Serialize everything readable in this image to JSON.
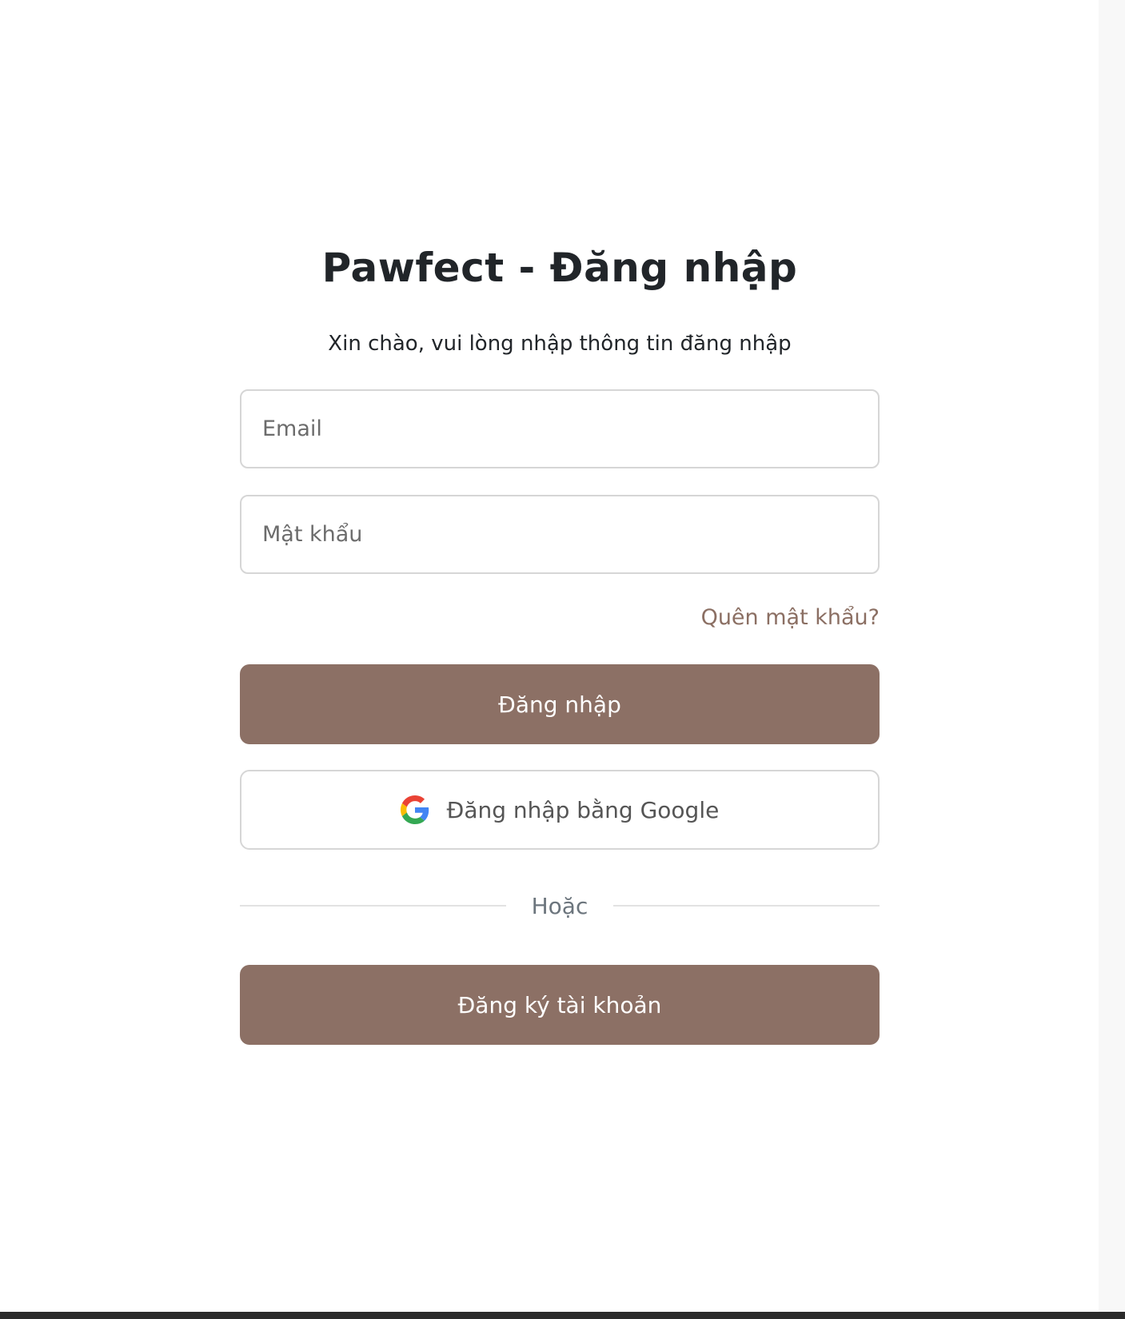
{
  "login": {
    "title": "Pawfect - Đăng nhập",
    "subtitle": "Xin chào, vui lòng nhập thông tin đăng nhập",
    "email_placeholder": "Email",
    "password_placeholder": "Mật khẩu",
    "forgot_password": "Quên mật khẩu?",
    "login_button": "Đăng nhập",
    "google_button": "Đăng nhập bằng Google",
    "divider_text": "Hoặc",
    "register_button": "Đăng ký tài khoản"
  },
  "icons": {
    "google": "google-g-logo"
  },
  "colors": {
    "primary": "#8c7065",
    "link": "#8b6f63",
    "title_text": "#212529",
    "border": "#d6d6d6",
    "google_blue": "#4285F4",
    "google_red": "#EA4335",
    "google_yellow": "#FBBC05",
    "google_green": "#34A853"
  }
}
